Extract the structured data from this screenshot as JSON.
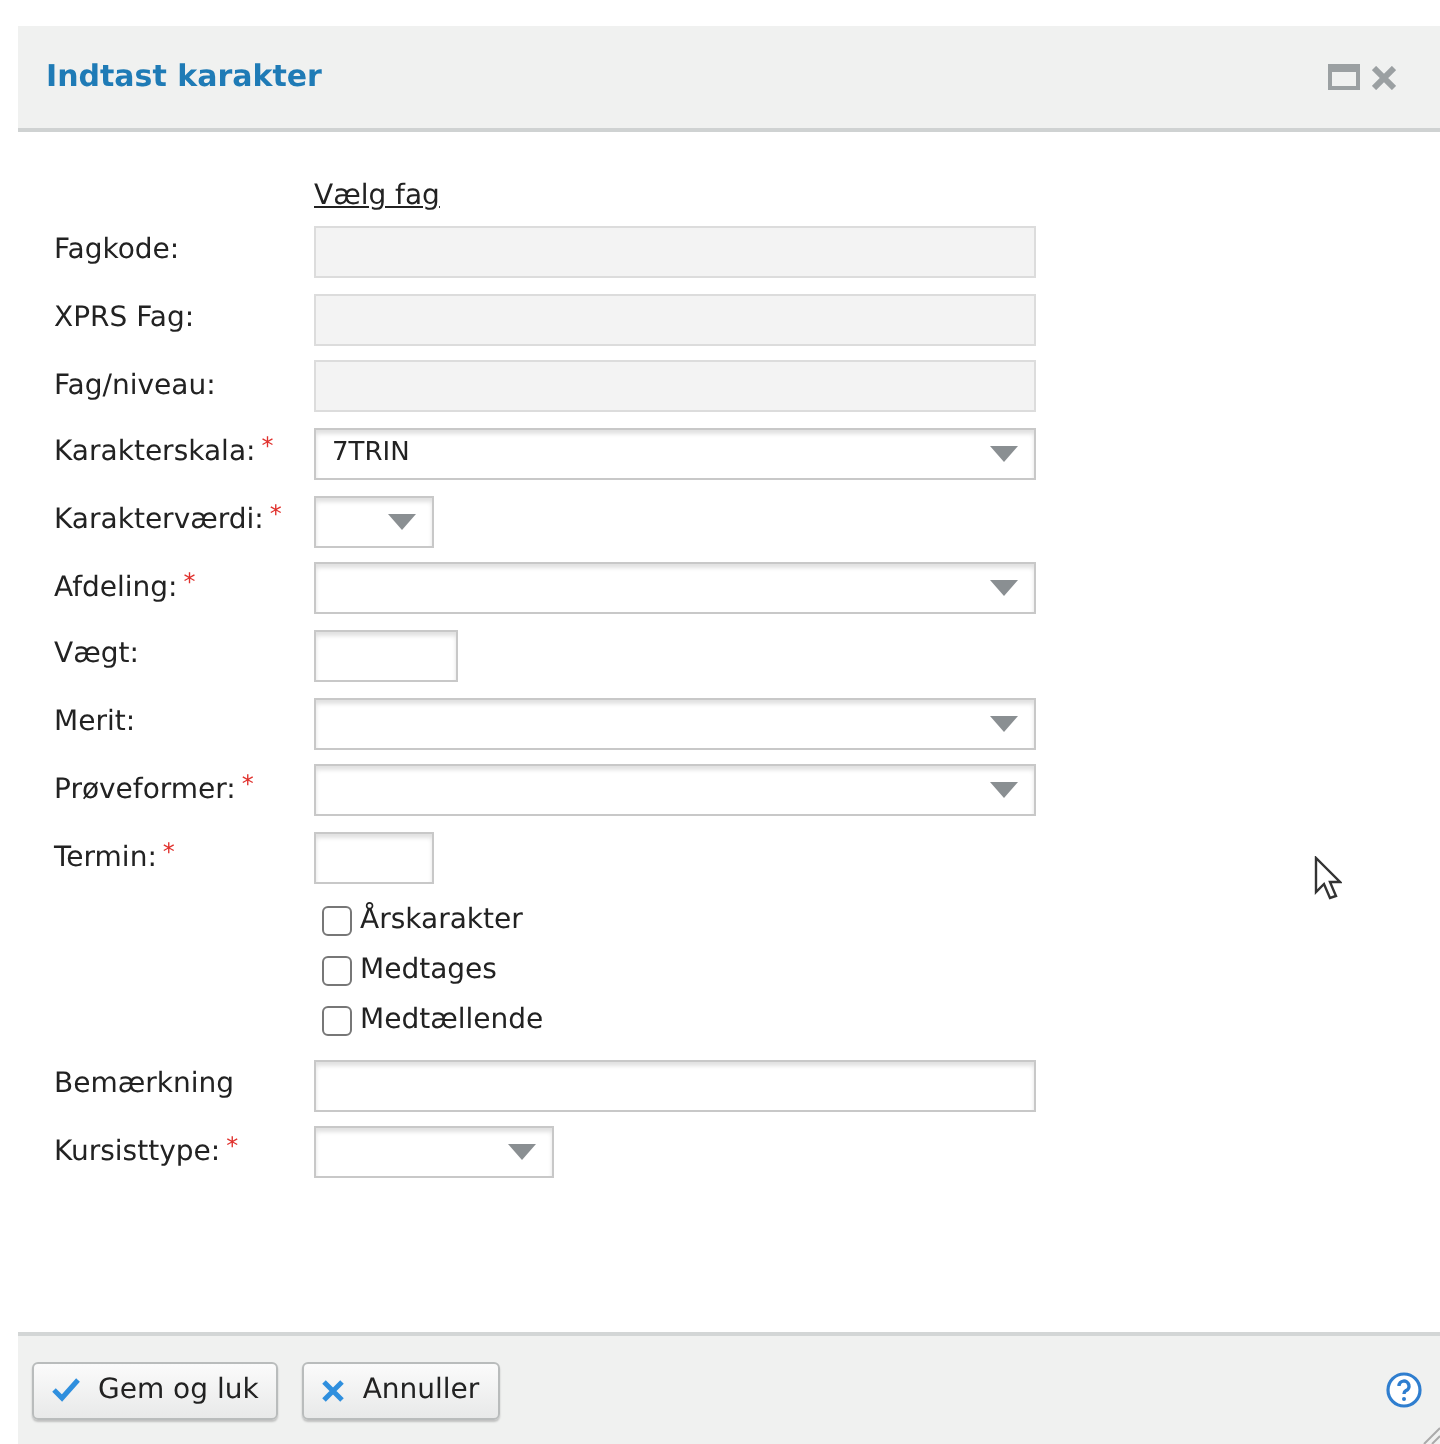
{
  "window": {
    "title": "Indtast karakter"
  },
  "link": "Vælg fag",
  "fields": [
    {
      "label": "Fagkode:",
      "kind": "readonly"
    },
    {
      "label": "XPRS Fag:",
      "kind": "readonly"
    },
    {
      "label": "Fag/niveau:",
      "kind": "readonly"
    },
    {
      "label": "Karakterskala:",
      "required_mark": "*",
      "kind": "dropdown",
      "value": "7TRIN"
    },
    {
      "label": "Karakterværdi:",
      "required_mark": "*",
      "kind": "dropdown-small"
    },
    {
      "label": "Afdeling:",
      "required_mark": "*",
      "kind": "dropdown"
    },
    {
      "label": "Vægt:",
      "kind": "text-medium"
    },
    {
      "label": "Merit:",
      "kind": "dropdown"
    },
    {
      "label": "Prøveformer:",
      "required_mark": "*",
      "kind": "dropdown"
    },
    {
      "label": "Termin:",
      "required_mark": "*",
      "kind": "text-small"
    }
  ],
  "checkboxes": [
    {
      "label": "Årskarakter",
      "checked": false
    },
    {
      "label": "Medtages",
      "checked": false
    },
    {
      "label": "Medtællende",
      "checked": false
    }
  ],
  "fields_after": [
    {
      "label": "Bemærkning",
      "kind": "text"
    },
    {
      "label": "Kursisttype:",
      "required_mark": "*",
      "kind": "dropdown-medium"
    }
  ],
  "buttons": [
    {
      "label": "Gem og luk",
      "kind": "ok"
    },
    {
      "label": "Annuller",
      "kind": "cancel"
    }
  ]
}
